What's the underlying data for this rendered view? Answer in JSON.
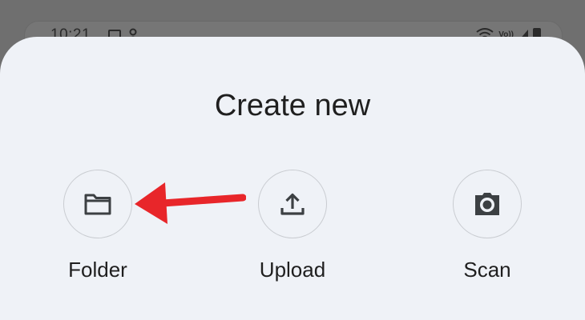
{
  "status_bar": {
    "time": "10:21",
    "network_label": "Vo))"
  },
  "sheet": {
    "title": "Create new",
    "options": [
      {
        "label": "Folder",
        "icon": "folder-icon"
      },
      {
        "label": "Upload",
        "icon": "upload-icon"
      },
      {
        "label": "Scan",
        "icon": "camera-icon"
      }
    ]
  },
  "annotation": {
    "arrow_color": "#e8262a",
    "points_to": "Folder"
  },
  "colors": {
    "sheet_background": "#eff2f7",
    "scrim": "#6f6f6f",
    "text": "#1f1f1f",
    "icon": "#3c4043",
    "button_border": "#c9ccd1"
  }
}
